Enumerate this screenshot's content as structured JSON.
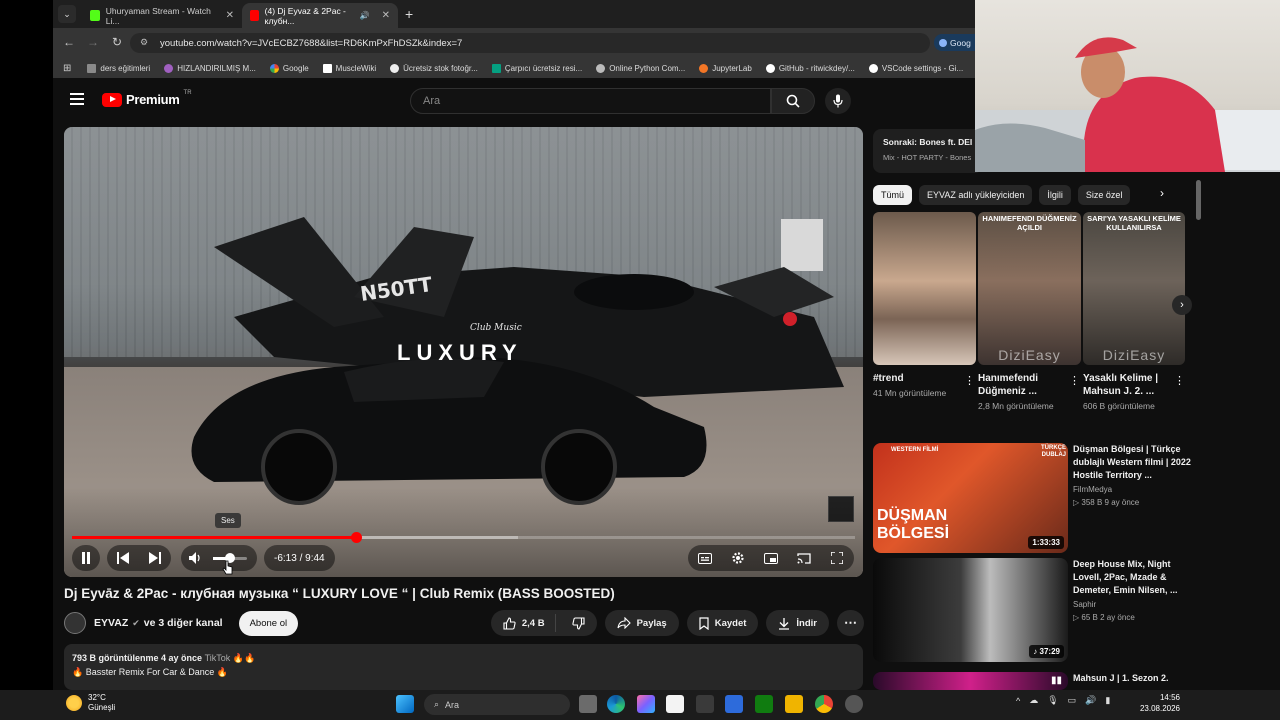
{
  "browser": {
    "tabs": [
      {
        "title": "Uhuryaman Stream - Watch Li...",
        "active": false
      },
      {
        "title": "(4) Dj Eyvaz & 2Pac - клубн...",
        "active": true
      }
    ],
    "new_tab": "+",
    "url": "youtube.com/watch?v=JVcECBZ7688&list=RD6KmPxFhDSZk&index=7",
    "google_chip": "Goog",
    "bookmarks": [
      "ders eğitimleri",
      "HIZLANDIRILMIŞ M...",
      "Google",
      "MuscleWiki",
      "Ücretsiz stok fotoğr...",
      "Çarpıcı ücretsiz resi...",
      "Online Python Com...",
      "JupyterLab",
      "GitHub - ritwickdey/...",
      "VSCode settings - Gi..."
    ]
  },
  "youtube": {
    "logo_word": "Premium",
    "logo_region": "TR",
    "search_placeholder": "Ara",
    "player": {
      "time": "-6:13 / 9:44",
      "played_fraction": 0.363,
      "buffered_fraction": 0.57,
      "volume_fraction": 0.5,
      "tooltip": "Ses",
      "overlay_title": "LUXURY",
      "overlay_sub": "Club Music",
      "tail_number": "N50TT"
    },
    "video": {
      "title": "Dj Eyvāz & 2Pac - клубная музыка “ LUXURY LOVE “ | Club Remix (BASS BOOSTED)",
      "channel": "EYVAZ",
      "collab": "ve 3 diğer kanal",
      "subscribe": "Abone ol",
      "likes": "2,4 B",
      "share": "Paylaş",
      "save": "Kaydet",
      "download": "İndir",
      "views_line": "793 B görüntülenme  4 ay önce",
      "tag": "TikTok",
      "desc_line": "Basster Remix For Car & Dance"
    },
    "sidebar": {
      "next_title": "Sonraki: Bones ft. DEI",
      "next_sub": "Mix - HOT PARTY - Bones",
      "chips": [
        "Tümü",
        "EYVAZ adlı yükleyiciden",
        "İlgili",
        "Size özel"
      ],
      "shorts": [
        {
          "caption": "",
          "title": "#trend",
          "meta": "41 Mn görüntüleme",
          "watermark": ""
        },
        {
          "caption": "HANIMEFENDI DÜĞMENİZ AÇILDI",
          "title": "Hanımefendi Düğmeniz ...",
          "meta": "2,8 Mn görüntüleme",
          "watermark": "DiziEasy"
        },
        {
          "caption": "SARI'YA YASAKLI KELİME KULLANILIRSA",
          "title": "Yasaklı Kelime | Mahsun J. 2. ...",
          "meta": "606 B görüntüleme",
          "watermark": "DiziEasy"
        }
      ],
      "videos": [
        {
          "title": "Düşman Bölgesi | Türkçe dublajlı Western filmi | 2022 Hostile Territory ...",
          "channel": "FilmMedya",
          "stats": "358 B  9 ay önce",
          "duration": "1:33:33",
          "thumb_text": "DÜŞMAN BÖLGESİ",
          "thumb_badge": "WESTERN FİLMİ",
          "thumb_corner": "TÜRKÇE DUBLAJ"
        },
        {
          "title": "Deep House Mix, Night Lovell, 2Pac, Mzade & Demeter, Emin Nilsen, ...",
          "channel": "Saphir",
          "stats": "65 B  2 ay önce",
          "duration": "37:29",
          "thumb_text": "",
          "thumb_badge": "",
          "thumb_corner": ""
        },
        {
          "title": "Mahsun J | 1. Sezon 2.",
          "channel": "",
          "stats": "",
          "duration": "",
          "thumb_text": "",
          "thumb_badge": "",
          "thumb_corner": ""
        }
      ]
    }
  },
  "taskbar": {
    "temp": "32°C",
    "weather": "Güneşli",
    "search": "Ara",
    "time": "14:56",
    "date": "23.08.2026"
  },
  "colors": {
    "accent": "#ff0000",
    "background": "#0f0f0f",
    "surface": "#272727"
  }
}
